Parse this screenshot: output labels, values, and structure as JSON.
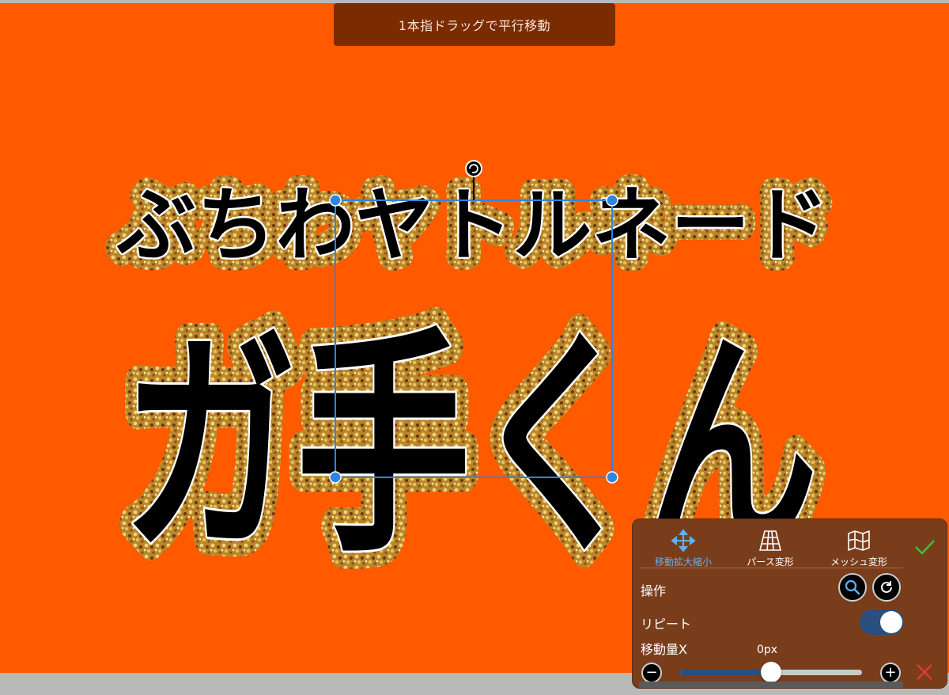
{
  "colors": {
    "canvas_bg": "#ff5a00",
    "hint_bg": "#7a2b00",
    "accent": "#5fb2f0",
    "confirm": "#3cbf3c",
    "cancel": "#e23b2e",
    "glitter_gold": "#c9982e",
    "glitter_dark": "#5a2a0a"
  },
  "hint": {
    "text": "1本指ドラッグで平行移動"
  },
  "artwork": {
    "line1": "ぶちわヤトルネード",
    "line2": "ガ手くん"
  },
  "panel": {
    "modes": [
      {
        "label": "移動拡大縮小",
        "icon": "move-arrows-icon",
        "active": true
      },
      {
        "label": "パース変形",
        "icon": "perspective-grid-icon",
        "active": false
      },
      {
        "label": "メッシュ変形",
        "icon": "mesh-map-icon",
        "active": false
      }
    ],
    "operation_label": "操作",
    "repeat_label": "リピート",
    "repeat_on": true,
    "movex_label": "移動量X",
    "movex_value": "0px",
    "slider_fraction": 0.5
  }
}
